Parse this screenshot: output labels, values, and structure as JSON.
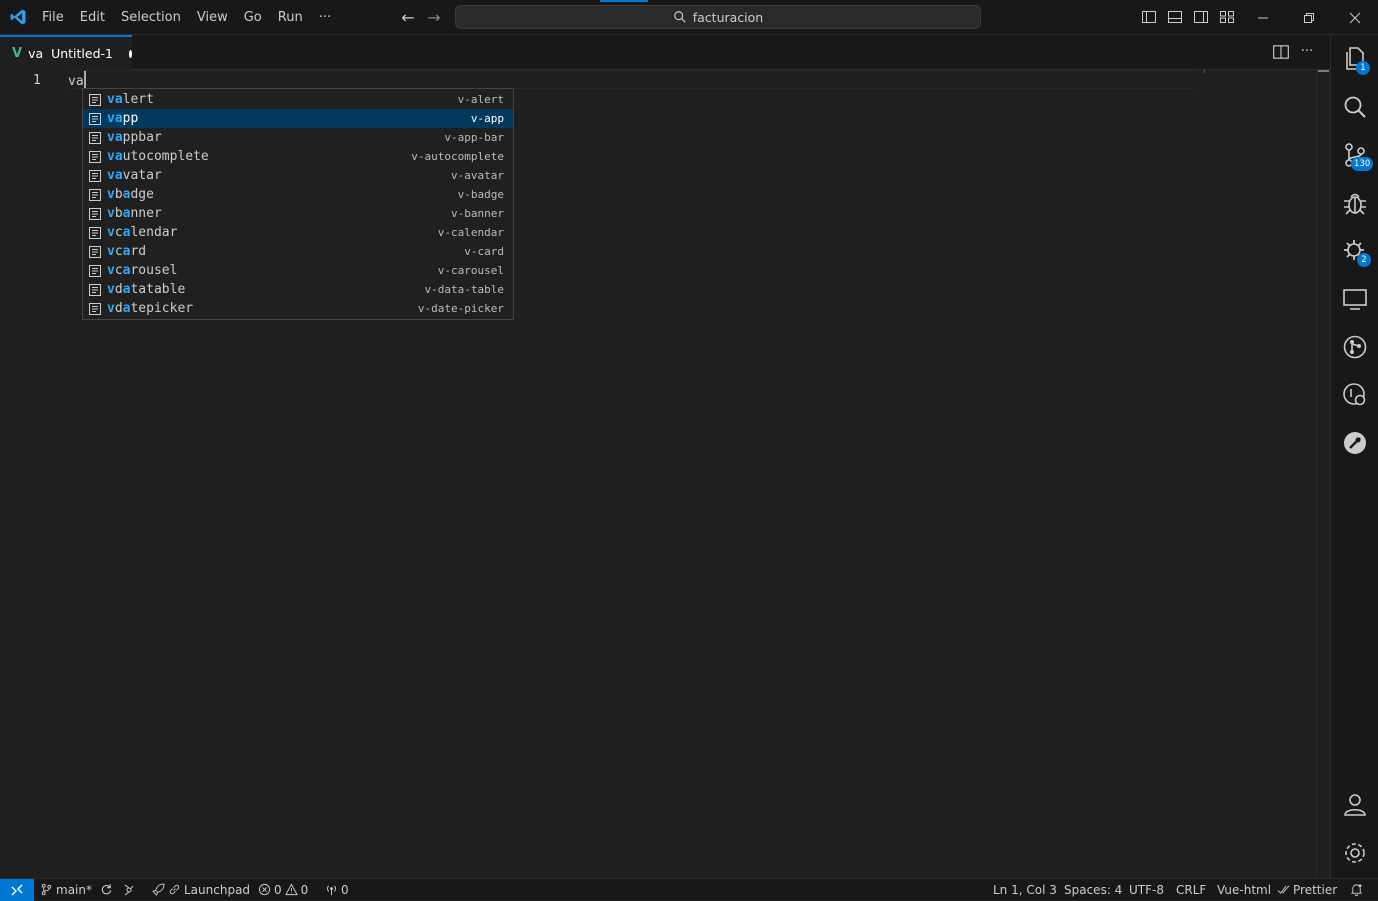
{
  "menu": [
    "File",
    "Edit",
    "Selection",
    "View",
    "Go",
    "Run",
    "···"
  ],
  "nav": {
    "back": "←",
    "forward": "→"
  },
  "command_center": {
    "text": "facturacion"
  },
  "tab": {
    "icon_label": "V",
    "title": "va  Untitled-1"
  },
  "tab_actions": {
    "split": "split-editor-icon",
    "more": "···"
  },
  "editor": {
    "line_number": "1",
    "text": "va"
  },
  "suggestions": [
    {
      "match": "va",
      "rest": "lert",
      "detail": "v-alert",
      "selected": false
    },
    {
      "match": "va",
      "rest": "pp",
      "detail": "v-app",
      "selected": true
    },
    {
      "match": "va",
      "rest": "ppbar",
      "detail": "v-app-bar",
      "selected": false
    },
    {
      "match": "va",
      "rest": "utocomplete",
      "detail": "v-autocomplete",
      "selected": false
    },
    {
      "match": "va",
      "rest": "vatar",
      "detail": "v-avatar",
      "selected": false
    },
    {
      "match": "v",
      "pre": "",
      "mid": "b",
      "match2": "a",
      "rest": "dge",
      "detail": "v-badge",
      "selected": false
    },
    {
      "match": "v",
      "mid": "b",
      "match2": "a",
      "rest": "nner",
      "detail": "v-banner",
      "selected": false
    },
    {
      "match": "v",
      "mid": "c",
      "match2": "a",
      "rest": "lendar",
      "detail": "v-calendar",
      "selected": false
    },
    {
      "match": "v",
      "mid": "c",
      "match2": "a",
      "rest": "rd",
      "detail": "v-card",
      "selected": false
    },
    {
      "match": "v",
      "mid": "c",
      "match2": "a",
      "rest": "rousel",
      "detail": "v-carousel",
      "selected": false
    },
    {
      "match": "v",
      "mid": "d",
      "match2": "a",
      "rest": "tatable",
      "detail": "v-data-table",
      "selected": false
    },
    {
      "match": "v",
      "mid": "d",
      "match2": "a",
      "rest": "tepicker",
      "detail": "v-date-picker",
      "selected": false
    }
  ],
  "activity_badges": {
    "explorer": "1",
    "scm": "130",
    "extensions": "2"
  },
  "status": {
    "branch": "main*",
    "launchpad": "Launchpad",
    "errors": "0",
    "warnings": "0",
    "ports": "0",
    "position": "Ln 1, Col 3",
    "spaces": "Spaces: 4",
    "encoding": "UTF-8",
    "eol": "CRLF",
    "language": "Vue-html",
    "formatter": "Prettier"
  },
  "colors": {
    "accent": "#0078d4",
    "vue": "#41b883",
    "highlight": "#2aaaff",
    "selected_row": "#04395e"
  }
}
